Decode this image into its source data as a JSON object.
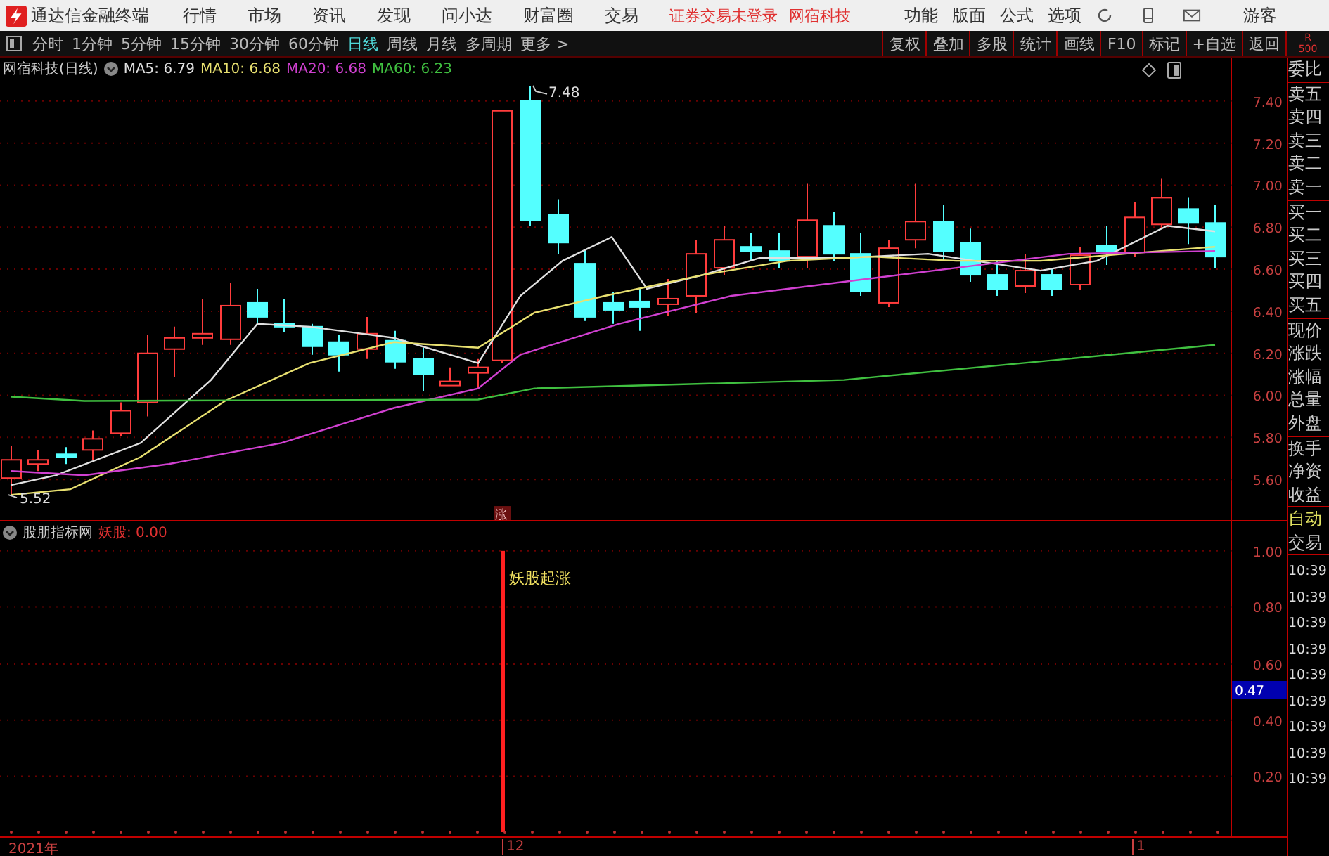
{
  "menu_bar": {
    "app_title": "通达信金融终端",
    "menus": [
      "行情",
      "市场",
      "资讯",
      "发现",
      "问小达",
      "财富圈",
      "交易"
    ],
    "status_texts": [
      "证券交易未登录",
      "网宿科技"
    ],
    "tools": [
      "功能",
      "版面",
      "公式",
      "选项"
    ],
    "user": "游客"
  },
  "toolbar": {
    "periods": [
      {
        "label": "分时",
        "selected": false
      },
      {
        "label": "1分钟",
        "selected": false
      },
      {
        "label": "5分钟",
        "selected": false
      },
      {
        "label": "15分钟",
        "selected": false
      },
      {
        "label": "30分钟",
        "selected": false
      },
      {
        "label": "60分钟",
        "selected": false
      },
      {
        "label": "日线",
        "selected": true
      },
      {
        "label": "周线",
        "selected": false
      },
      {
        "label": "月线",
        "selected": false
      },
      {
        "label": "多周期",
        "selected": false
      }
    ],
    "more": "更多 >",
    "actions": [
      "复权",
      "叠加",
      "多股",
      "统计",
      "画线",
      "F10",
      "标记",
      "+自选",
      "返回"
    ],
    "corner_badge": [
      "R",
      "500"
    ]
  },
  "price_chart": {
    "title": "网宿科技(日线)",
    "ma_legend": [
      {
        "label": "MA5: 6.79",
        "color": "#e0e0e0"
      },
      {
        "label": "MA10: 6.68",
        "color": "#e8e070"
      },
      {
        "label": "MA20: 6.68",
        "color": "#d040d0"
      },
      {
        "label": "MA60: 6.23",
        "color": "#40c040"
      }
    ],
    "y_axis_labels": [
      "7.40",
      "7.20",
      "7.00",
      "6.80",
      "6.60",
      "6.40",
      "6.20",
      "6.00",
      "5.80",
      "5.60"
    ],
    "high_label": "7.48",
    "low_label": "5.52",
    "signal_marker": "涨"
  },
  "indicator": {
    "title": "股朋指标网",
    "value_label": "妖股: 0.00",
    "signal_text": "妖股起涨",
    "y_axis_labels": [
      "1.00",
      "0.80",
      "0.60",
      "0.40",
      "0.20"
    ],
    "current_value": "0.47"
  },
  "x_axis": {
    "labels": [
      "2021年",
      "12",
      "1"
    ]
  },
  "quote_panel": {
    "groups": [
      [
        "委比"
      ],
      [
        "卖五",
        "卖四",
        "卖三",
        "卖二",
        "卖一"
      ],
      [
        "买一",
        "买二",
        "买三",
        "买四",
        "买五"
      ],
      [
        "现价",
        "涨跌",
        "涨幅",
        "总量",
        "外盘"
      ],
      [
        "换手",
        "净资",
        "收益"
      ]
    ],
    "auto_label": "自动",
    "trade_label": "交易",
    "times": [
      "10:39",
      "10:39",
      "10:39",
      "10:39",
      "10:39",
      "10:39",
      "10:39",
      "10:39",
      "10:39"
    ]
  }
}
